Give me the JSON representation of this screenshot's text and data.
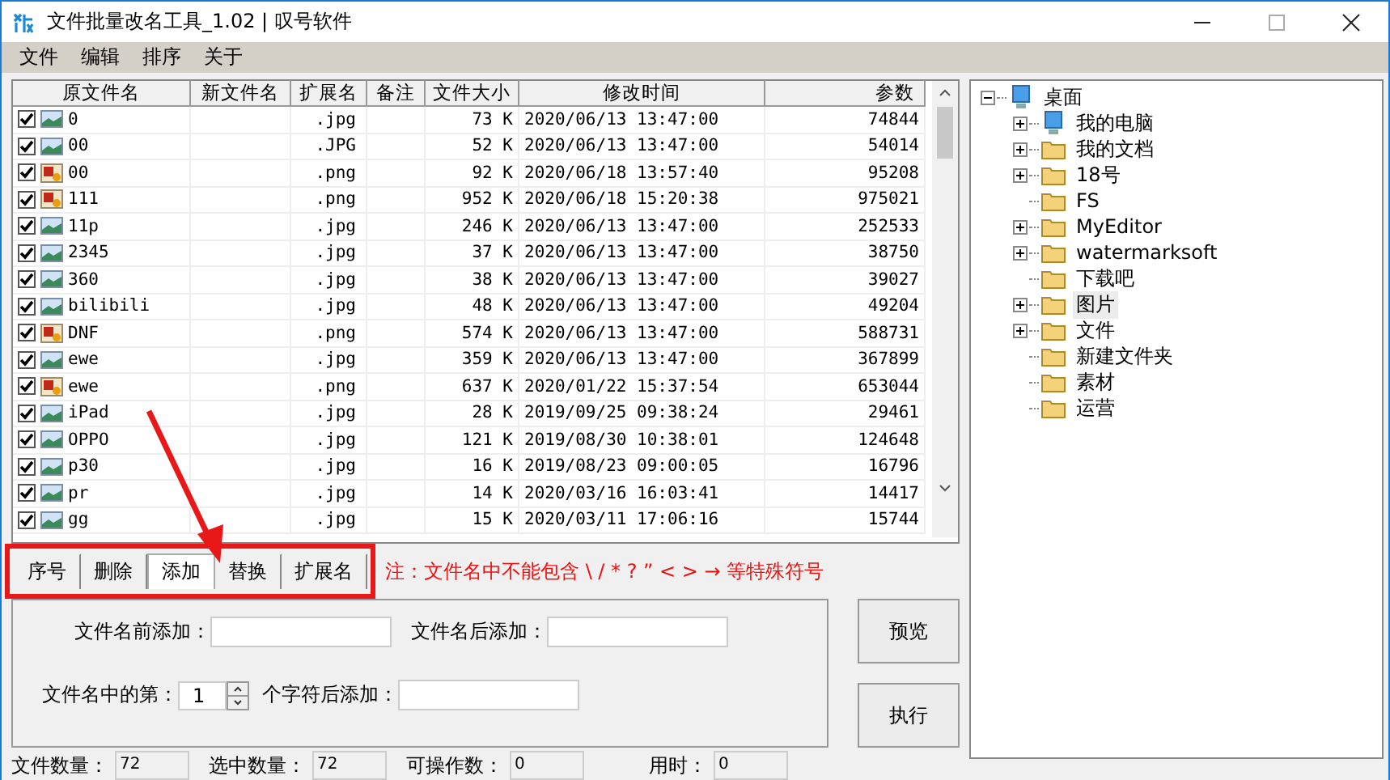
{
  "window": {
    "title": "文件批量改名工具_1.02 | 叹号软件"
  },
  "menu": [
    "文件",
    "编辑",
    "排序",
    "关于"
  ],
  "table": {
    "columns": [
      "原文件名",
      "新文件名",
      "扩展名",
      "备注",
      "文件大小",
      "修改时间",
      "参数"
    ],
    "rows": [
      {
        "checked": true,
        "kind": "landscape",
        "name": "0",
        "ext": ".jpg",
        "size": "73 K",
        "time": "2020/06/13 13:47:00",
        "param": "74844"
      },
      {
        "checked": true,
        "kind": "landscape",
        "name": "00",
        "ext": ".JPG",
        "size": "52 K",
        "time": "2020/06/13 13:47:00",
        "param": "54014"
      },
      {
        "checked": true,
        "kind": "paint",
        "name": "00",
        "ext": ".png",
        "size": "92 K",
        "time": "2020/06/18 13:57:40",
        "param": "95208"
      },
      {
        "checked": true,
        "kind": "paint",
        "name": "111",
        "ext": ".png",
        "size": "952 K",
        "time": "2020/06/18 15:20:38",
        "param": "975021"
      },
      {
        "checked": true,
        "kind": "landscape",
        "name": "11p",
        "ext": ".jpg",
        "size": "246 K",
        "time": "2020/06/13 13:47:00",
        "param": "252533"
      },
      {
        "checked": true,
        "kind": "landscape",
        "name": "2345",
        "ext": ".jpg",
        "size": "37 K",
        "time": "2020/06/13 13:47:00",
        "param": "38750"
      },
      {
        "checked": true,
        "kind": "landscape",
        "name": "360",
        "ext": ".jpg",
        "size": "38 K",
        "time": "2020/06/13 13:47:00",
        "param": "39027"
      },
      {
        "checked": true,
        "kind": "landscape",
        "name": "bilibili",
        "ext": ".jpg",
        "size": "48 K",
        "time": "2020/06/13 13:47:00",
        "param": "49204"
      },
      {
        "checked": true,
        "kind": "paint",
        "name": "DNF",
        "ext": ".png",
        "size": "574 K",
        "time": "2020/06/13 13:47:00",
        "param": "588731"
      },
      {
        "checked": true,
        "kind": "landscape",
        "name": "ewe",
        "ext": ".jpg",
        "size": "359 K",
        "time": "2020/06/13 13:47:00",
        "param": "367899"
      },
      {
        "checked": true,
        "kind": "paint",
        "name": "ewe",
        "ext": ".png",
        "size": "637 K",
        "time": "2020/01/22 15:37:54",
        "param": "653044"
      },
      {
        "checked": true,
        "kind": "landscape",
        "name": "iPad",
        "ext": ".jpg",
        "size": "28 K",
        "time": "2019/09/25 09:38:24",
        "param": "29461"
      },
      {
        "checked": true,
        "kind": "landscape",
        "name": "OPPO",
        "ext": ".jpg",
        "size": "121 K",
        "time": "2019/08/30 10:38:01",
        "param": "124648"
      },
      {
        "checked": true,
        "kind": "landscape",
        "name": "p30",
        "ext": ".jpg",
        "size": "16 K",
        "time": "2019/08/23 09:00:05",
        "param": "16796"
      },
      {
        "checked": true,
        "kind": "landscape",
        "name": "pr",
        "ext": ".jpg",
        "size": "14 K",
        "time": "2020/03/16 16:03:41",
        "param": "14417"
      },
      {
        "checked": true,
        "kind": "landscape",
        "name": "gg",
        "ext": ".jpg",
        "size": "15 K",
        "time": "2020/03/11 17:06:16",
        "param": "15744"
      }
    ]
  },
  "tabs": [
    {
      "label": "序号",
      "selected": false
    },
    {
      "label": "删除",
      "selected": false
    },
    {
      "label": "添加",
      "selected": true
    },
    {
      "label": "替换",
      "selected": false
    },
    {
      "label": "扩展名",
      "selected": false
    }
  ],
  "note": "注：文件名中不能包含 \\ /  * ? ” < > → 等特殊符号",
  "add_panel": {
    "prefix_label": "文件名前添加：",
    "suffix_label": "文件名后添加：",
    "position_label": "文件名中的第：",
    "position_value": "1",
    "after_label": "个字符后添加："
  },
  "buttons": [
    "预览",
    "执行"
  ],
  "status_bar": [
    {
      "label": "文件数量：",
      "value": "72"
    },
    {
      "label": "选中数量：",
      "value": "72"
    },
    {
      "label": "可操作数：",
      "value": "0"
    },
    {
      "label": "用时：",
      "value": "0"
    }
  ],
  "tree": [
    {
      "label": "桌面",
      "kind": "computer",
      "expanded": true,
      "selected": false,
      "children": [
        {
          "label": "我的电脑",
          "kind": "computer",
          "expanded": false,
          "selected": false
        },
        {
          "label": "我的文档",
          "kind": "folder",
          "expanded": false,
          "selected": false
        },
        {
          "label": "18号",
          "kind": "folder",
          "expanded": false,
          "selected": false
        },
        {
          "label": "FS",
          "kind": "folder",
          "selected": false
        },
        {
          "label": "MyEditor",
          "kind": "folder",
          "expanded": false,
          "selected": false
        },
        {
          "label": "watermarksoft",
          "kind": "folder",
          "expanded": false,
          "selected": false
        },
        {
          "label": "下载吧",
          "kind": "folder",
          "selected": false
        },
        {
          "label": "图片",
          "kind": "folder",
          "expanded": false,
          "selected": true
        },
        {
          "label": "文件",
          "kind": "folder",
          "expanded": false,
          "selected": false
        },
        {
          "label": "新建文件夹",
          "kind": "folder",
          "selected": false
        },
        {
          "label": "素材",
          "kind": "folder",
          "selected": false
        },
        {
          "label": "运营",
          "kind": "folder",
          "selected": false
        }
      ]
    }
  ]
}
